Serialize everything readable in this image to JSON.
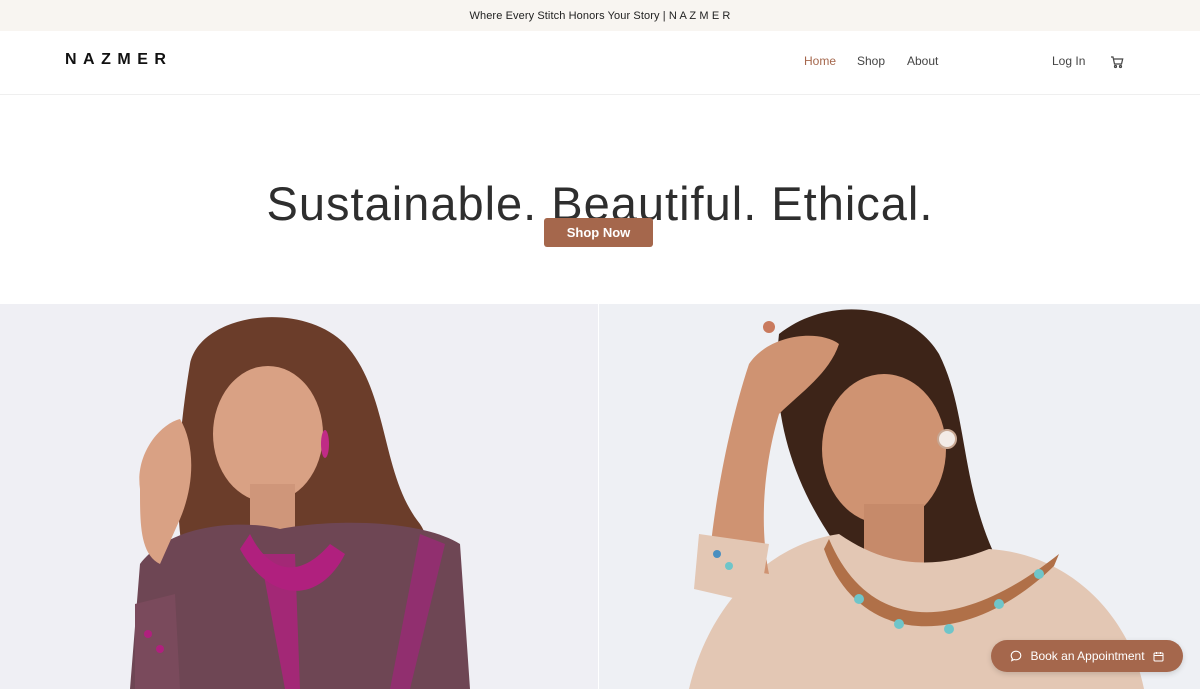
{
  "announcement": {
    "text": "Where Every Stitch Honors Your Story | N A Z M E R"
  },
  "header": {
    "logo": "NAZMER",
    "nav": [
      {
        "label": "Home",
        "active": true
      },
      {
        "label": "Shop",
        "active": false
      },
      {
        "label": "About",
        "active": false
      }
    ],
    "login_label": "Log In",
    "cart_icon": "cart-icon"
  },
  "hero": {
    "title": "Sustainable. Beautiful. Ethical.",
    "cta_label": "Shop Now"
  },
  "gallery": {
    "images": [
      {
        "name": "model-plum-embroidered-kurta"
      },
      {
        "name": "model-beige-embellished-kurta"
      }
    ]
  },
  "floating": {
    "appointment_label": "Book an Appointment",
    "chat_icon": "chat-bubble-icon",
    "calendar_icon": "calendar-icon"
  },
  "colors": {
    "accent": "#a5674c",
    "announcement_bg": "#f8f5f1"
  }
}
